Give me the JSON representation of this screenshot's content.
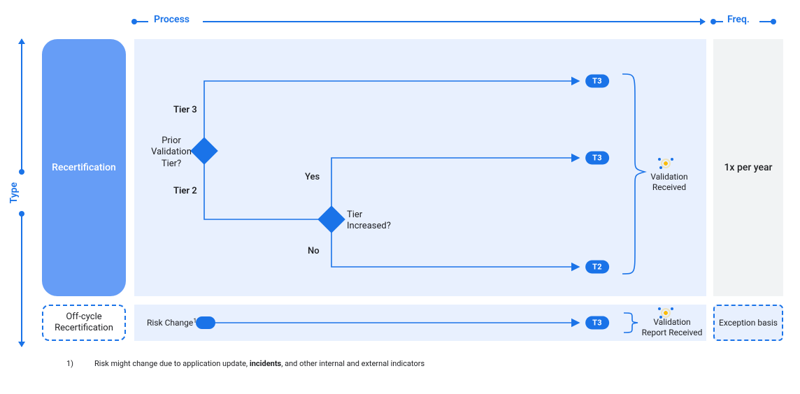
{
  "axes": {
    "type_label": "Type",
    "process_label": "Process",
    "freq_label": "Freq."
  },
  "left": {
    "recert": "Recertification",
    "offcycle": "Off-cycle Recertification"
  },
  "flow": {
    "q1": "Prior Validation Tier?",
    "q1_tier3": "Tier 3",
    "q1_tier2": "Tier 2",
    "q2": "Tier Increased?",
    "q2_yes": "Yes",
    "q2_no": "No",
    "pill_t3": "T3",
    "pill_t2": "T2",
    "validation_received": "Validation Received"
  },
  "offcycle": {
    "risk_change": "Risk Change",
    "risk_sup": "1",
    "pill": "T3",
    "validation_report": "Validation Report Received"
  },
  "freq": {
    "top": "1x per year",
    "bottom": "Exception basis"
  },
  "footnote": {
    "num": "1)",
    "before": "Risk might change due to application update, ",
    "bold": "incidents",
    "after": ", and other internal and external indicators"
  }
}
